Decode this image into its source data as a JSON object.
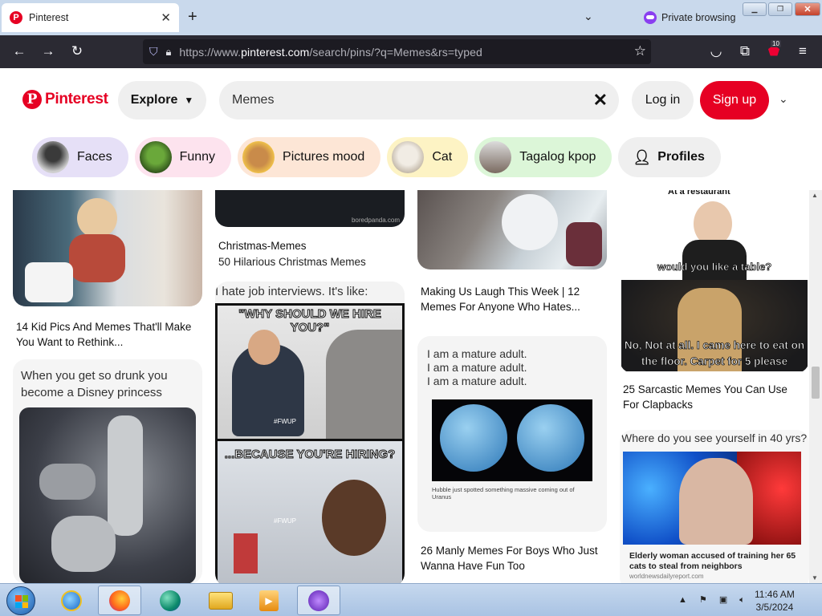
{
  "browser": {
    "tab_title": "Pinterest",
    "private_label": "Private browsing",
    "url_prefix": "https://www.",
    "url_domain": "pinterest.com",
    "url_path": "/search/pins/?q=Memes&rs=typed",
    "extension_badge": "10"
  },
  "header": {
    "logo_text": "Pinterest",
    "explore_label": "Explore",
    "search_value": "Memes",
    "login_label": "Log in",
    "signup_label": "Sign up"
  },
  "chips": [
    {
      "label": "Faces",
      "bg": "#e6e0f7"
    },
    {
      "label": "Funny",
      "bg": "#fde3ee"
    },
    {
      "label": "Pictures mood",
      "bg": "#fde6d6"
    },
    {
      "label": "Cat",
      "bg": "#fdf3c4"
    },
    {
      "label": "Tagalog kpop",
      "bg": "#dcf6d8"
    },
    {
      "label": "Profiles",
      "bg": "#efefef"
    }
  ],
  "pins": {
    "col1": [
      {
        "title": "14 Kid Pics And Memes That'll Make You Want to Rethink..."
      },
      {
        "caption": "When you get so drunk you become a Disney princess"
      }
    ],
    "col2": [
      {
        "watermark": "boredpanda.com",
        "title": "Christmas-Memes",
        "subtitle": "50 Hilarious Christmas Memes"
      },
      {
        "caption": "I hate job interviews. It's like:",
        "top_text": "\"WHY SHOULD WE HIRE YOU?\"",
        "bottom_text": "...BECAUSE YOU'RE HIRING?",
        "tag1": "#FWUP",
        "tag2": "#FWUP"
      }
    ],
    "col3": [
      {
        "title": "Making Us Laugh This Week | 12 Memes For Anyone Who Hates..."
      },
      {
        "lines": [
          "I am a mature adult.",
          "I am a mature adult.",
          "I am a mature adult."
        ],
        "headline": "Hubble just spotted something massive coming out of Uranus",
        "title": "26 Manly Memes For Boys Who Just Wanna Have Fun Too"
      }
    ],
    "col4": [
      {
        "top_text": "At a restaurant",
        "q_text": "would you like a table?",
        "a_text": "No, Not at all. I came here to eat on the floor. Carpet for 5 please",
        "title": "25 Sarcastic Memes You Can Use For Clapbacks"
      },
      {
        "caption": "Where do you see yourself in 40 yrs?",
        "headline": "Elderly woman accused of training her 65 cats to steal from neighbors",
        "source": "worldnewsdailyreport.com"
      }
    ]
  },
  "taskbar": {
    "time": "11:46 AM",
    "date": "3/5/2024"
  }
}
